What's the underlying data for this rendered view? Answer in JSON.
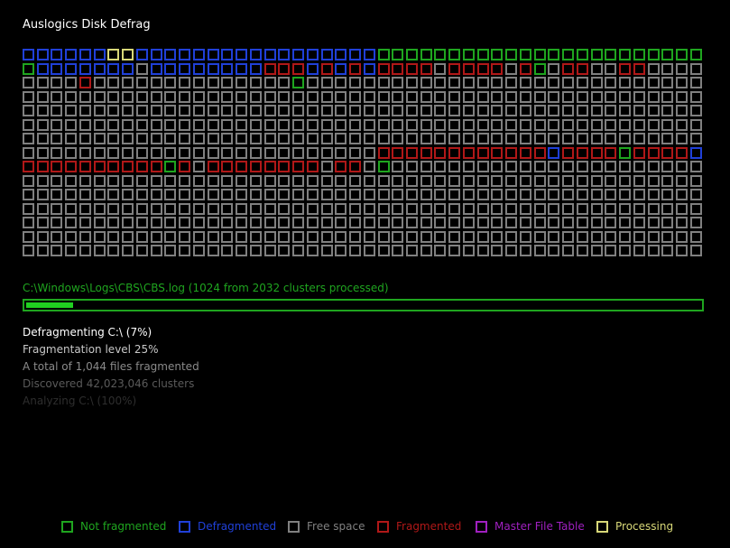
{
  "app": {
    "title": "Auslogics Disk Defrag"
  },
  "colors": {
    "not_fragmented": "#1fa51f",
    "defragmented": "#2040d8",
    "free_space": "#808080",
    "fragmented": "#b01818",
    "master_file_table": "#a020c0",
    "processing": "#d8d878",
    "progress": "#20d020",
    "path_text": "#1fa51f"
  },
  "cluster_map": {
    "columns": 48,
    "rows": 15,
    "legend_codes": {
      "N": "not_fragmented",
      "D": "defragmented",
      "F": "free_space",
      "X": "fragmented",
      "M": "master_file_table",
      "P": "processing"
    },
    "grid": [
      "DDDDDDPPDDDDDDDDDDDDDDDDDNNNNNNNNNNNNNNNNNNNNNNN",
      "NDDDDDDDFDDDDDDDDXXXDXDXDXXXXFXXXXFXNFXXFFXXFFFF",
      "FFFFXFFFFFFFFFFFFFFNFFFFFFFFFFFFFFFFFFFFFFFFFFFF",
      "FFFFFFFFFFFFFFFFFFFFFFFFFFFFFFFFFFFFFFFFFFFFFFFF",
      "FFFFFFFFFFFFFFFFFFFFFFFFFFFFFFFFFFFFFFFFFFFFFFFF",
      "FFFFFFFFFFFFFFFFFFFFFFFFFFFFFFFFFFFFFFFFFFFFFFFF",
      "FFFFFFFFFFFFFFFFFFFFFFFFFFFFFFFFFFFFFFFFFFFFFFFF",
      "FFFFFFFFFFFFFFFFFFFFFFFFFXXXXXXXXXXXXDXXXXNXXXXDXX",
      "XXXXXXXXXXNXFXXXXXXXXFXXFNFFFFFFFFFFFFFFFFFFFFFF",
      "FFFFFFFFFFFFFFFFFFFFFFFFFFFFFFFFFFFFFFFFFFFFFFFF",
      "FFFFFFFFFFFFFFFFFFFFFFFFFFFFFFFFFFFFFFFFFFFFFFFF",
      "FFFFFFFFFFFFFFFFFFFFFFFFFFFFFFFFFFFFFFFFFFFFFFFF",
      "FFFFFFFFFFFFFFFFFFFFFFFFFFFFFFFFFFFFFFFFFFFFFFFF",
      "FFFFFFFFFFFFFFFFFFFFFFFFFFFFFFFFFFFFFFFFFFFFFFFF",
      "FFFFFFFFFFFFFFFFFFFFFFFFFFFFFFFFFFFFFFFFFFFFFFFF"
    ]
  },
  "current_file": "C:\\Windows\\Logs\\CBS\\CBS.log (1024 from 2032 clusters processed)",
  "progress": {
    "fraction": 0.07
  },
  "status": {
    "line1": {
      "text": "Defragmenting C:\\ (7%)",
      "color": "#ffffff"
    },
    "line2": {
      "text": "Fragmentation level 25%",
      "color": "#c8c8c8"
    },
    "line3": {
      "text": "A total of 1,044 files fragmented",
      "color": "#8a8a8a"
    },
    "line4": {
      "text": "Discovered 42,023,046 clusters",
      "color": "#5a5a5a"
    },
    "line5": {
      "text": "Analyzing C:\\ (100%)",
      "color": "#2e2e2e"
    }
  },
  "legend": [
    {
      "key": "not_fragmented",
      "label": "Not fragmented"
    },
    {
      "key": "defragmented",
      "label": "Defragmented"
    },
    {
      "key": "free_space",
      "label": "Free space"
    },
    {
      "key": "fragmented",
      "label": "Fragmented"
    },
    {
      "key": "master_file_table",
      "label": "Master File Table"
    },
    {
      "key": "processing",
      "label": "Processing"
    }
  ]
}
